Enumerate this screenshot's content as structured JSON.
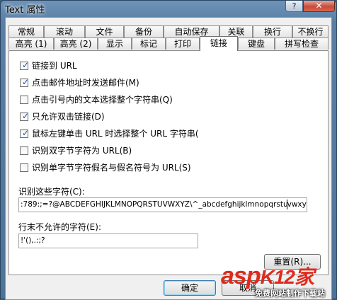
{
  "window": {
    "title": "Text 属性",
    "help_glyph": "?",
    "close_glyph": "✕"
  },
  "tabs": {
    "row1": [
      "常规",
      "滚动",
      "文件",
      "备份",
      "自动保存",
      "关联",
      "换行",
      "不换行"
    ],
    "row2": [
      "高亮 (1)",
      "高亮 (2)",
      "显示",
      "标记",
      "打印",
      "链接",
      "键盘",
      "拼写检查"
    ],
    "active": "链接"
  },
  "options": [
    {
      "label": "链接到 URL",
      "checked": true
    },
    {
      "label": "点击邮件地址时发送邮件(M)",
      "checked": true
    },
    {
      "label": "点击引号内的文本选择整个字符串(Q)",
      "checked": false
    },
    {
      "label": "只允许双击链接(D)",
      "checked": true
    },
    {
      "label": "鼠标左键单击 URL 时选择整个 URL 字符串(",
      "checked": true
    },
    {
      "label": "识别双字节字符为 URL(B)",
      "checked": false
    },
    {
      "label": "识别单字节字符假名与假名符号为 URL(S)",
      "checked": false
    }
  ],
  "recognize_chars": {
    "label": "识别这些字符(C):",
    "value_before_caret": ":789:;=?@ABCDEFGHIJKLMNOPQRSTUVWXYZ\\^_abcdefghijklmnopqrstu",
    "value_after_caret": "vwxyz~"
  },
  "line_end_chars": {
    "label": "行末不允许的字符(E):",
    "value": "!'(),.:;?"
  },
  "buttons": {
    "reset": "重置(R)...",
    "ok": "确定",
    "cancel": "取消"
  },
  "watermark": {
    "logo": "asp",
    "logo_suffix": "K12家",
    "sub": "免费网站制作下载站"
  }
}
